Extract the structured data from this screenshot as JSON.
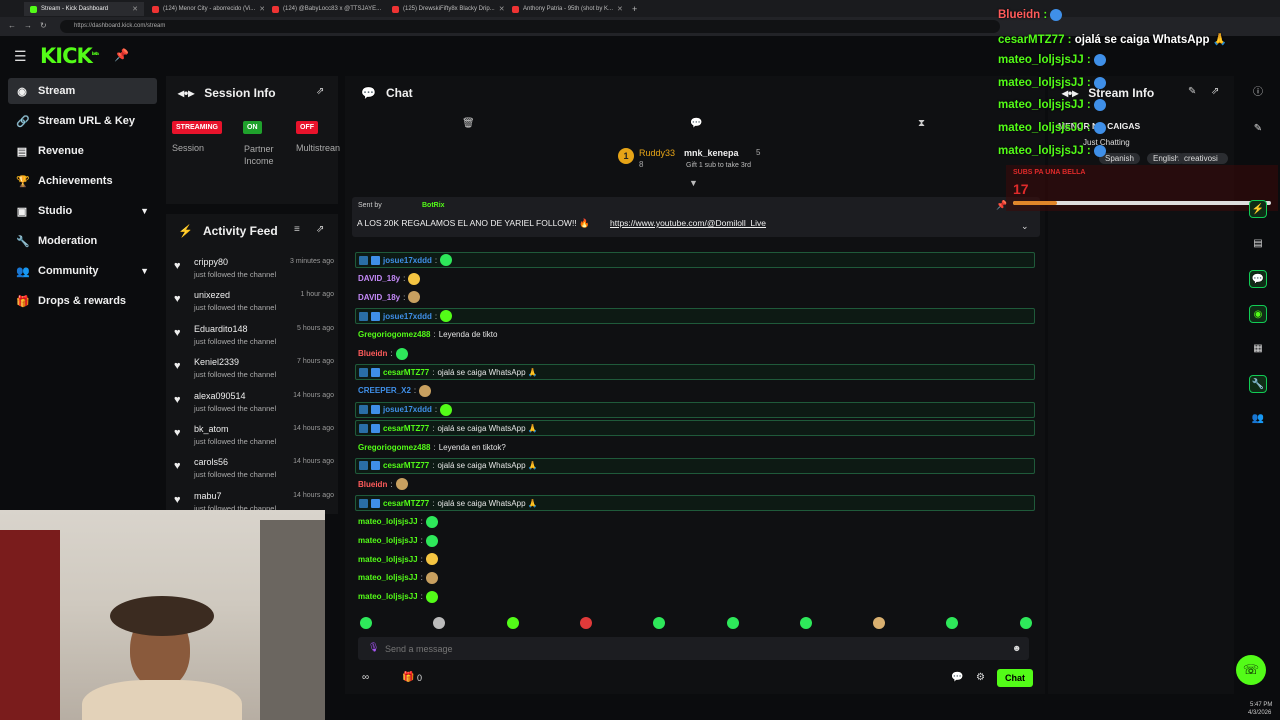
{
  "browser": {
    "tabs": [
      "Stream - Kick Dashboard",
      "(124) Menor City - aborrecido (Vi...",
      "(124) @BabyLocc83 x @TTSJAYE...",
      "(125) DrewskiFifty8x Blacky Drip...",
      "Anthony Patria - 95th (shot by K..."
    ],
    "url": "https://dashboard.kick.com/stream"
  },
  "logo": "KICK",
  "logo_sup": "beta",
  "sidebar": {
    "items": [
      {
        "label": "Stream",
        "icon": "broadcast-icon",
        "glyph": "((•))"
      },
      {
        "label": "Stream URL & Key",
        "icon": "link-icon",
        "glyph": "🔗"
      },
      {
        "label": "Revenue",
        "icon": "chart-icon",
        "glyph": "▮"
      },
      {
        "label": "Achievements",
        "icon": "trophy-icon",
        "glyph": "🏆"
      },
      {
        "label": "Studio",
        "icon": "studio-icon",
        "glyph": "▣"
      },
      {
        "label": "Moderation",
        "icon": "wrench-icon",
        "glyph": "🔧"
      },
      {
        "label": "Community",
        "icon": "users-icon",
        "glyph": "👥"
      },
      {
        "label": "Drops & rewards",
        "icon": "gift-icon",
        "glyph": "🎁"
      }
    ]
  },
  "session": {
    "title": "Session Info",
    "badges": [
      {
        "text": "STREAMING",
        "color": "#e8132b",
        "label": "Session"
      },
      {
        "text": "ON",
        "color": "#1fa12c",
        "label": "Partner\nIncome"
      },
      {
        "text": "OFF",
        "color": "#e8132b",
        "label": "Multistrean"
      }
    ]
  },
  "activity": {
    "title": "Activity Feed",
    "items": [
      {
        "name": "crippy80",
        "desc": "just followed the channel",
        "time": "3 minutes ago"
      },
      {
        "name": "unixezed",
        "desc": "just followed the channel",
        "time": "1 hour ago"
      },
      {
        "name": "Eduardito148",
        "desc": "just followed the channel",
        "time": "5 hours ago"
      },
      {
        "name": "Keniel2339",
        "desc": "just followed the channel",
        "time": "7 hours ago"
      },
      {
        "name": "alexa090514",
        "desc": "just followed the channel",
        "time": "14 hours ago"
      },
      {
        "name": "bk_atom",
        "desc": "just followed the channel",
        "time": "14 hours ago"
      },
      {
        "name": "carols56",
        "desc": "just followed the channel",
        "time": "14 hours ago"
      },
      {
        "name": "mabu7",
        "desc": "just followed the channel",
        "time": "14 hours ago"
      }
    ]
  },
  "chat": {
    "title": "Chat",
    "gift": {
      "rank": "1",
      "user": "Ruddy33",
      "count": "8",
      "target": "mnk_kenepa",
      "target_count": "5",
      "text": "Gift 1 sub to take 3rd"
    },
    "pinned": {
      "sent_by": "Sent by",
      "bot": "BotRix",
      "text": "A LOS 20K REGALAMOS EL ANO DE YARIEL FOLLOW!! 🔥",
      "link": "https://www.youtube.com/@Domiloll_Live"
    },
    "messages": [
      {
        "user": "josue17xddd",
        "text": "",
        "color": "#3f8fe8",
        "hl": true
      },
      {
        "user": "DAVID_18y",
        "text": "",
        "color": "#c58af9",
        "hl": false
      },
      {
        "user": "DAVID_18y",
        "text": "",
        "color": "#c58af9",
        "hl": false
      },
      {
        "user": "josue17xddd",
        "text": "",
        "color": "#3f8fe8",
        "hl": true
      },
      {
        "user": "Gregoriogomez488",
        "text": "Leyenda de tikto",
        "color": "#53fc18",
        "hl": false
      },
      {
        "user": "Blueidn",
        "text": "",
        "color": "#ff5b5b",
        "hl": false
      },
      {
        "user": "cesarMTZ77",
        "text": "ojalá se caiga WhatsApp 🙏",
        "color": "#53fc18",
        "hl": true
      },
      {
        "user": "CREEPER_X2",
        "text": "",
        "color": "#3f8fe8",
        "hl": false
      },
      {
        "user": "josue17xddd",
        "text": "",
        "color": "#3f8fe8",
        "hl": true
      },
      {
        "user": "cesarMTZ77",
        "text": "ojalá se caiga WhatsApp 🙏",
        "color": "#53fc18",
        "hl": true
      },
      {
        "user": "Gregoriogomez488",
        "text": "Leyenda en tiktok?",
        "color": "#53fc18",
        "hl": false
      },
      {
        "user": "cesarMTZ77",
        "text": "ojalá se caiga WhatsApp 🙏",
        "color": "#53fc18",
        "hl": true
      },
      {
        "user": "Blueidn",
        "text": "",
        "color": "#ff5b5b",
        "hl": false
      },
      {
        "user": "cesarMTZ77",
        "text": "ojalá se caiga WhatsApp 🙏",
        "color": "#53fc18",
        "hl": true
      },
      {
        "user": "mateo_loljsjsJJ",
        "text": "",
        "color": "#53fc18",
        "hl": false
      },
      {
        "user": "mateo_loljsjsJJ",
        "text": "",
        "color": "#53fc18",
        "hl": false
      },
      {
        "user": "mateo_loljsjsJJ",
        "text": "",
        "color": "#53fc18",
        "hl": false
      },
      {
        "user": "mateo_loljsjsJJ",
        "text": "",
        "color": "#53fc18",
        "hl": false
      },
      {
        "user": "mateo_loljsjsJJ",
        "text": "",
        "color": "#53fc18",
        "hl": false
      }
    ],
    "placeholder": "Send a message",
    "points": "0",
    "send_label": "Chat"
  },
  "stream_info": {
    "title": "Stream Info",
    "stream_title": "MENOR NO CAIGAS",
    "category": "Just Chatting",
    "tags": [
      "Spanish",
      "English",
      "creativosi"
    ]
  },
  "overlay": {
    "lines": [
      {
        "user": "Blueidn",
        "text": "",
        "color": "#ff5b5b"
      },
      {
        "user": "cesarMTZ77",
        "text": "ojalá se caiga WhatsApp 🙏",
        "color": "#53fc18"
      },
      {
        "user": "mateo_loljsjsJJ",
        "text": "",
        "color": "#53fc18"
      },
      {
        "user": "mateo_loljsjsJJ",
        "text": "",
        "color": "#53fc18"
      },
      {
        "user": "mateo_loljsjsJJ",
        "text": "",
        "color": "#53fc18"
      },
      {
        "user": "mateo_loljsjsJJ",
        "text": "",
        "color": "#53fc18"
      },
      {
        "user": "mateo_loljsjsJJ",
        "text": "",
        "color": "#53fc18"
      }
    ],
    "goal_text": "SUBS PA UNA BELLA",
    "goal_value": "17"
  },
  "clock": {
    "time": "5:47 PM",
    "date": "4/3/2026"
  },
  "colors": {
    "accent": "#53fc18",
    "live": "#e8132b"
  }
}
